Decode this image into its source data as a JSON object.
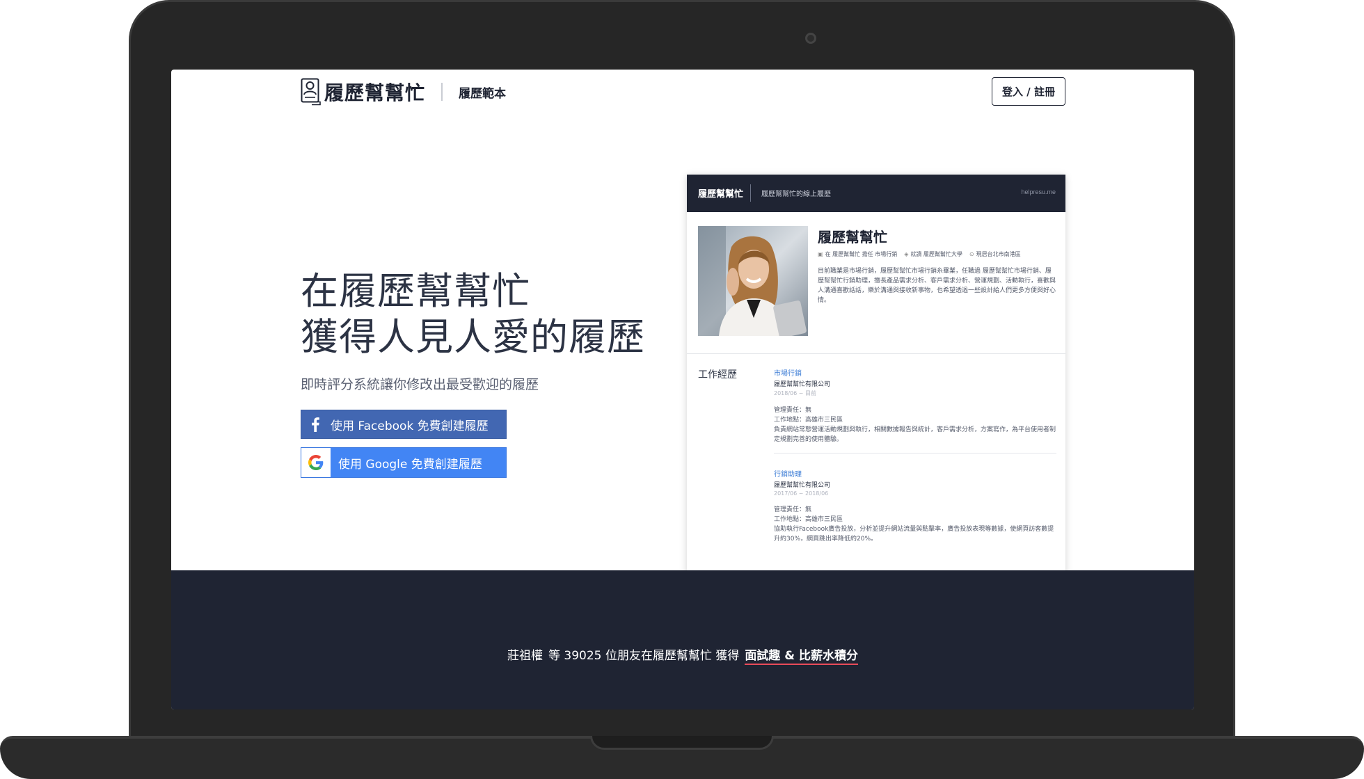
{
  "header": {
    "logo_text": "履歷幫幫忙",
    "nav_templates": "履歷範本",
    "login_label": "登入 / 註冊"
  },
  "hero": {
    "title_line1": "在履歷幫幫忙",
    "title_line2": "獲得人見人愛的履歷",
    "subtitle": "即時評分系統讓你修改出最受歡迎的履歷",
    "facebook_button": "使用 Facebook 免費創建履歷",
    "google_button": "使用 Google 免費創建履歷"
  },
  "resume_preview": {
    "brand": "履歷幫幫忙",
    "tagline": "履歷幫幫忙的線上履歷",
    "domain": "helpresu.me",
    "name": "履歷幫幫忙",
    "meta": {
      "job": "在 履歷幫幫忙 擔任 市場行銷",
      "school": "就讀 履歷幫幫忙大學",
      "location": "現居台北市南港區"
    },
    "bio": "目前職業是市場行銷，履歷幫幫忙市場行銷糸畢業，任職過 履歷幫幫忙市場行銷、履歷幫幫忙行銷助理，擅長產品需求分析、客戶需求分析、營運規劃、活動執行，喜歡與人溝通喜歡話話，樂於溝通與接收新事物，也希望透過一些設計給人們更多方便與好心情。",
    "section_title": "工作經歷",
    "jobs": [
      {
        "title": "市場行銷",
        "company": "履歷幫幫忙有限公司",
        "dates": "2018/06 ~ 目前",
        "duty": "管理責任：無",
        "location": "工作地點：高雄市三民區",
        "desc": "負責網站常態營運活動規劃與執行，相關數據報告與統計，客戶需求分析，方案寫作，為平台使用者制定規劃完善的使用體驗。"
      },
      {
        "title": "行銷助理",
        "company": "履歷幫幫忙有限公司",
        "dates": "2017/06 ~ 2018/06",
        "duty": "管理責任：無",
        "location": "工作地點：高雄市三民區",
        "desc": "協助執行Facebook廣告投放，分析並提升網站流量與點擊率，廣告投放表現等數據，使網頁訪客數提升約30%，網頁跳出率降低約20%。"
      }
    ]
  },
  "footer": {
    "user_name": "莊祖權",
    "text_mid": "等 39025 位朋友在履歷幫幫忙 獲得",
    "highlight": "面試趣 & 比薪水積分"
  },
  "colors": {
    "dark_navy": "#1f2433",
    "facebook_blue": "#4267b2",
    "google_blue": "#4285f4",
    "job_title_blue": "#3a7bd5",
    "highlight_underline": "#e94b5a"
  }
}
